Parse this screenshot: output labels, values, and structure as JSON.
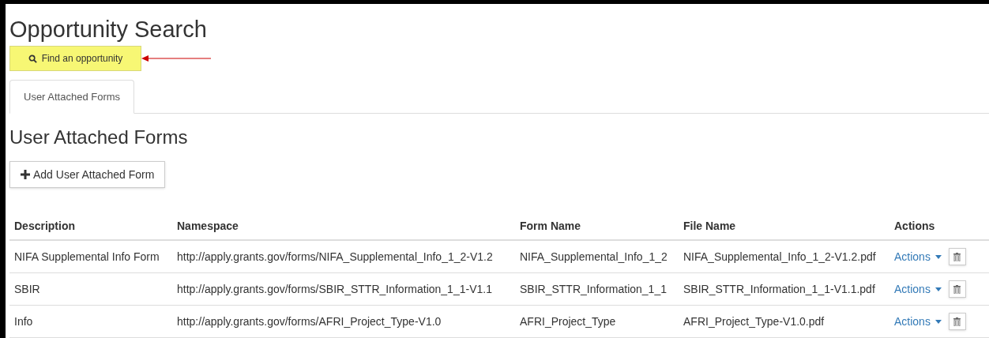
{
  "page_title": "Opportunity Search",
  "find_button": {
    "label": "Find an opportunity"
  },
  "tabs": [
    {
      "label": "User Attached Forms",
      "selected": true
    }
  ],
  "section_title": "User Attached Forms",
  "add_button": {
    "label": "Add User Attached Form"
  },
  "table": {
    "columns": [
      "Description",
      "Namespace",
      "Form Name",
      "File Name",
      "Actions"
    ],
    "rows": [
      {
        "description": "NIFA Supplemental Info Form",
        "namespace": "http://apply.grants.gov/forms/NIFA_Supplemental_Info_1_2-V1.2",
        "form_name": "NIFA_Supplemental_Info_1_2",
        "file_name": "NIFA_Supplemental_Info_1_2-V1.2.pdf",
        "action": "Actions"
      },
      {
        "description": "SBIR",
        "namespace": "http://apply.grants.gov/forms/SBIR_STTR_Information_1_1-V1.1",
        "form_name": "SBIR_STTR_Information_1_1",
        "file_name": "SBIR_STTR_Information_1_1-V1.1.pdf",
        "action": "Actions"
      },
      {
        "description": "Info",
        "namespace": "http://apply.grants.gov/forms/AFRI_Project_Type-V1.0",
        "form_name": "AFRI_Project_Type",
        "file_name": "AFRI_Project_Type-V1.0.pdf",
        "action": "Actions"
      }
    ]
  }
}
